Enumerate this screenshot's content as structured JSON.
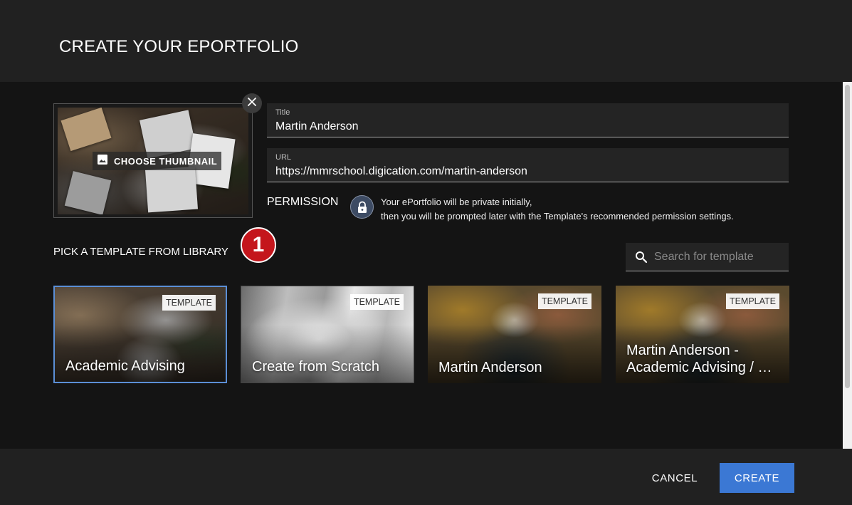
{
  "dialog": {
    "title": "CREATE YOUR EPORTFOLIO"
  },
  "thumbnail": {
    "choose_label": "CHOOSE THUMBNAIL"
  },
  "fields": {
    "title_label": "Title",
    "title_value": "Martin Anderson",
    "url_label": "URL",
    "url_value": "https://mmrschool.digication.com/martin-anderson"
  },
  "permission": {
    "label": "PERMISSION",
    "line1": "Your ePortfolio will be private initially,",
    "line2": "then you will be prompted later with the Template's recommended permission settings."
  },
  "library": {
    "label": "PICK A TEMPLATE FROM LIBRARY",
    "step_badge": "1",
    "search_placeholder": "Search for template",
    "templates": [
      {
        "name": "Academic Advising",
        "tag": "TEMPLATE",
        "selected": true
      },
      {
        "name": "Create from Scratch",
        "tag": "TEMPLATE",
        "selected": false
      },
      {
        "name": "Martin Anderson",
        "tag": "TEMPLATE",
        "selected": false
      },
      {
        "name": "Martin Anderson - Academic Advising / …",
        "tag": "TEMPLATE",
        "selected": false
      }
    ]
  },
  "footer": {
    "cancel_label": "CANCEL",
    "create_label": "CREATE"
  },
  "colors": {
    "accent": "#3b78d4",
    "badge": "#c4161c",
    "selected_border": "#5b8fd6"
  }
}
